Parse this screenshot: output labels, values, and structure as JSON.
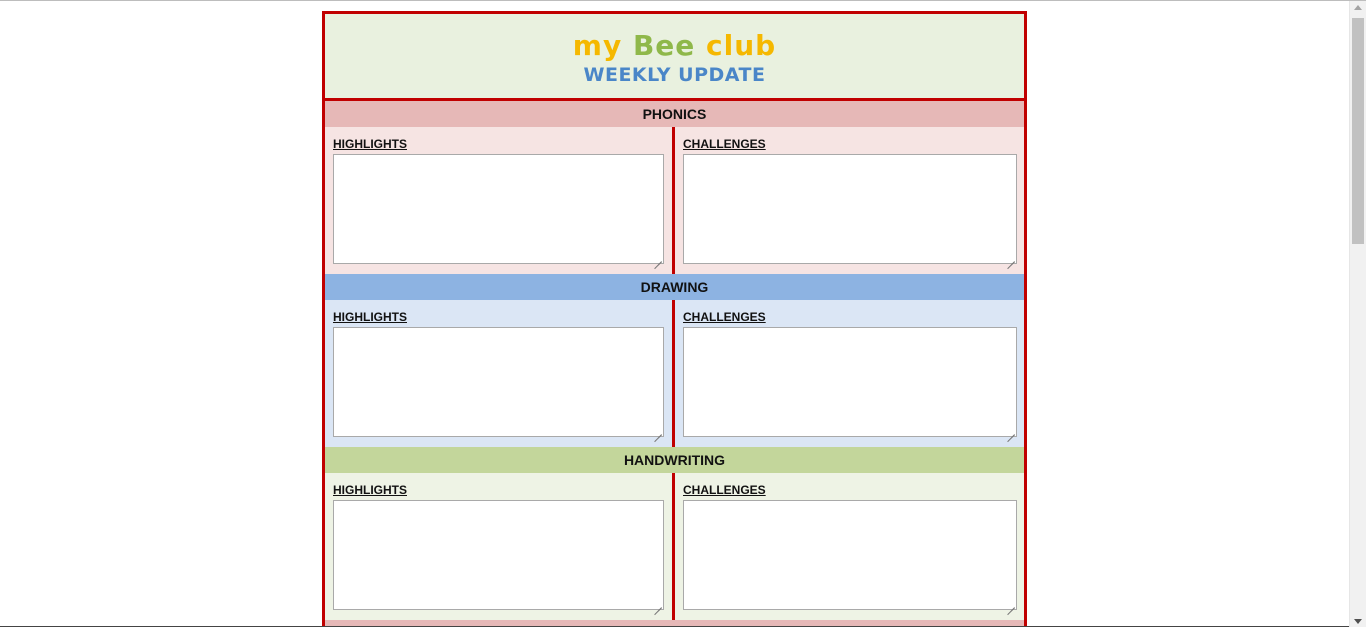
{
  "header": {
    "club_name_part1": "my",
    "club_name_part2": "Bee",
    "club_name_part3": "club",
    "subtitle": "WEEKLY UPDATE"
  },
  "sections": [
    {
      "title": "PHONICS",
      "highlights_label": "HIGHLIGHTS",
      "highlights_value": "",
      "challenges_label": "CHALLENGES",
      "challenges_value": ""
    },
    {
      "title": "DRAWING",
      "highlights_label": "HIGHLIGHTS",
      "highlights_value": "",
      "challenges_label": "CHALLENGES",
      "challenges_value": ""
    },
    {
      "title": "HANDWRITING",
      "highlights_label": "HIGHLIGHTS",
      "highlights_value": "",
      "challenges_label": "CHALLENGES",
      "challenges_value": ""
    }
  ],
  "colors": {
    "border": "#c00000",
    "header_bg": "#e9f1df",
    "club_yellow": "#f5b800",
    "club_green": "#8fb84a",
    "subtitle_blue": "#4a86c8",
    "phonics_title_bg": "#e6b8b7",
    "phonics_body_bg": "#f6e4e3",
    "drawing_title_bg": "#8db3e2",
    "drawing_body_bg": "#dbe6f5",
    "handwriting_title_bg": "#c3d69b",
    "handwriting_body_bg": "#eef3e5"
  },
  "scrollbar": {
    "icons": [
      "scroll-up-arrow-icon",
      "scroll-down-arrow-icon"
    ]
  }
}
